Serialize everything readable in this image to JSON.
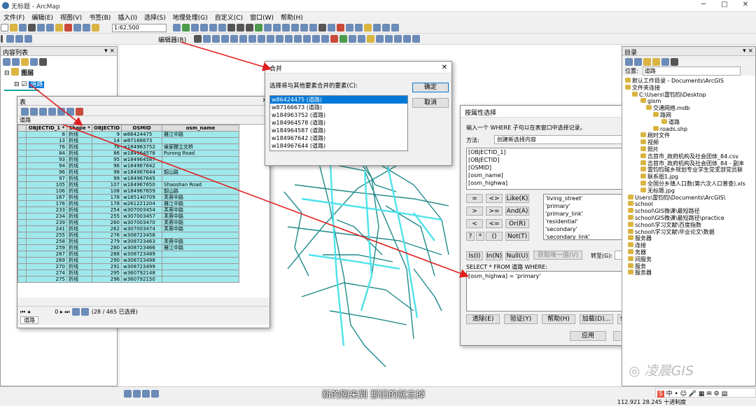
{
  "window": {
    "title": "无标题 - ArcMap"
  },
  "menu": [
    "文件(F)",
    "编辑(E)",
    "视图(V)",
    "书签(B)",
    "插入(I)",
    "选择(S)",
    "地理处理(G)",
    "自定义(C)",
    "窗口(W)",
    "帮助(H)"
  ],
  "toolbar": {
    "scale": "1:62,500",
    "editor": "编辑器(R)"
  },
  "toc": {
    "title": "内容列表",
    "pin": "▾ ×",
    "layers_label": "图层",
    "layer_name": "道路"
  },
  "table": {
    "title": "表",
    "layer_tab": "道路",
    "columns": [
      "OBJECTID_1 *",
      "Shape *",
      "OBJECTID",
      "OSMID",
      "osm_name"
    ],
    "rows": [
      [
        "8",
        "折线",
        "9",
        "w86424475",
        "雅江中路"
      ],
      [
        "13",
        "折线",
        "14",
        "w87166673",
        ""
      ],
      [
        "76",
        "折线",
        "78",
        "w184963752",
        "侯家鞭立交桥"
      ],
      [
        "84",
        "折线",
        "86",
        "w184964578",
        "Purong Road"
      ],
      [
        "93",
        "折线",
        "95",
        "w184964587",
        ""
      ],
      [
        "94",
        "折线",
        "96",
        "w184967642",
        ""
      ],
      [
        "96",
        "折线",
        "98",
        "w184967644",
        "韶山路"
      ],
      [
        "97",
        "折线",
        "99",
        "w184967645",
        ""
      ],
      [
        "105",
        "折线",
        "107",
        "w184967650",
        "Shaoshan Road"
      ],
      [
        "106",
        "折线",
        "108",
        "w184967659",
        "韶山路"
      ],
      [
        "167",
        "折线",
        "178",
        "w185140709",
        "芙蓉中路"
      ],
      [
        "176",
        "折线",
        "178",
        "w261221204",
        "雅江中路"
      ],
      [
        "233",
        "折线",
        "254",
        "w307003454",
        "芙蓉中路"
      ],
      [
        "234",
        "折线",
        "255",
        "w307003457",
        "芙蓉中路"
      ],
      [
        "239",
        "折线",
        "260",
        "w307003470",
        "芙蓉中路"
      ],
      [
        "241",
        "折线",
        "262",
        "w307003474",
        "芙蓉中路"
      ],
      [
        "255",
        "折线",
        "276",
        "w308723458",
        ""
      ],
      [
        "258",
        "折线",
        "279",
        "w308723463",
        "芙蓉中路"
      ],
      [
        "259",
        "折线",
        "280",
        "w308723466",
        "雅江中路"
      ],
      [
        "267",
        "折线",
        "288",
        "w308723489",
        ""
      ],
      [
        "269",
        "折线",
        "290",
        "w308723498",
        ""
      ],
      [
        "270",
        "折线",
        "291",
        "w308723499",
        ""
      ],
      [
        "274",
        "折线",
        "295",
        "w360792148",
        ""
      ],
      [
        "275",
        "折线",
        "296",
        "w360792150",
        ""
      ]
    ],
    "nav_current": "0",
    "selection_status": "(28 / 465 已选择)"
  },
  "merge": {
    "title": "合并",
    "prompt": "选择将与其他要素合并的要素(C):",
    "items": [
      "w86424475 (道路)",
      "w87166673 (道路)",
      "w184963752 (道路)",
      "w184964578 (道路)",
      "w184964587 (道路)",
      "w184967642 (道路)",
      "w184967644 (道路)"
    ],
    "ok": "确定",
    "cancel": "取消"
  },
  "attr_select": {
    "title": "按属性选择",
    "instruction": "输入一个 WHERE 子句以在表窗口中选择记录。",
    "method_label": "方法:",
    "method_value": "创建新选择内容",
    "fields": [
      "[OBJECTID_1]",
      "[OBJECTID]",
      "[OSMID]",
      "[osm_name]",
      "[osm_highwa]"
    ],
    "operators": [
      "=",
      "<>",
      "Like(K)",
      ">",
      ">=",
      "And(A)",
      "<",
      "<=",
      "Or(R)",
      "?",
      "*",
      "()",
      "Not(T)",
      "Is(I)",
      "In(N)",
      "Null(U)"
    ],
    "values": [
      "'living_street'",
      "'primary'",
      "'primary_link'",
      "'residential'",
      "'secondary'",
      "'secondary_link'"
    ],
    "unique_btn": "获取唯一值(V)",
    "goto_label": "转至(G):",
    "sql_header": "SELECT * FROM 道路 WHERE:",
    "expression": "[osm_highwa] = 'primary'",
    "buttons": [
      "清除(E)",
      "验证(Y)",
      "帮助(H)",
      "加载(D)...",
      "保存(V)..."
    ],
    "apply": "应用",
    "close": "关闭"
  },
  "catalog": {
    "title": "目录",
    "location_label": "位置:",
    "location_value": "道路",
    "items": [
      "默认工作目录 - Documents\\ArcGIS",
      "文件夹连接",
      "C:\\Users\\雷钧钧\\Desktop",
      "gism",
      "交通网络.mdb",
      "路网",
      "道路",
      "roads.shp",
      "刷时文件",
      "视频",
      "照片",
      "吉首市_政府机构及社会团体_84.csv",
      "吉首市_政府机构及社会团体_84 - 副本",
      "雷钧钧城乡规划专业学生党支部党员联",
      "联系图1.jpg",
      "全国分乡镇人口数(第六次人口普查).xls",
      "无标题.jpg",
      "Users\\雷钧钧\\Documents\\ArcGIS\\",
      "school",
      "school\\GIS微课\\最短路径",
      "school\\GIS微课\\最短路径\\practice",
      "school\\学习文献\\百度指数",
      "school\\学习文献\\毕业论文\\数据",
      "服务器",
      "连接",
      "务器",
      "间服务",
      "服务",
      "服务器"
    ]
  },
  "status": {
    "coords": "112.921  28.245 十进制度"
  },
  "subtitle": "新的刚来到 那旧的就忘掉",
  "watermark": "凌晨GIS"
}
